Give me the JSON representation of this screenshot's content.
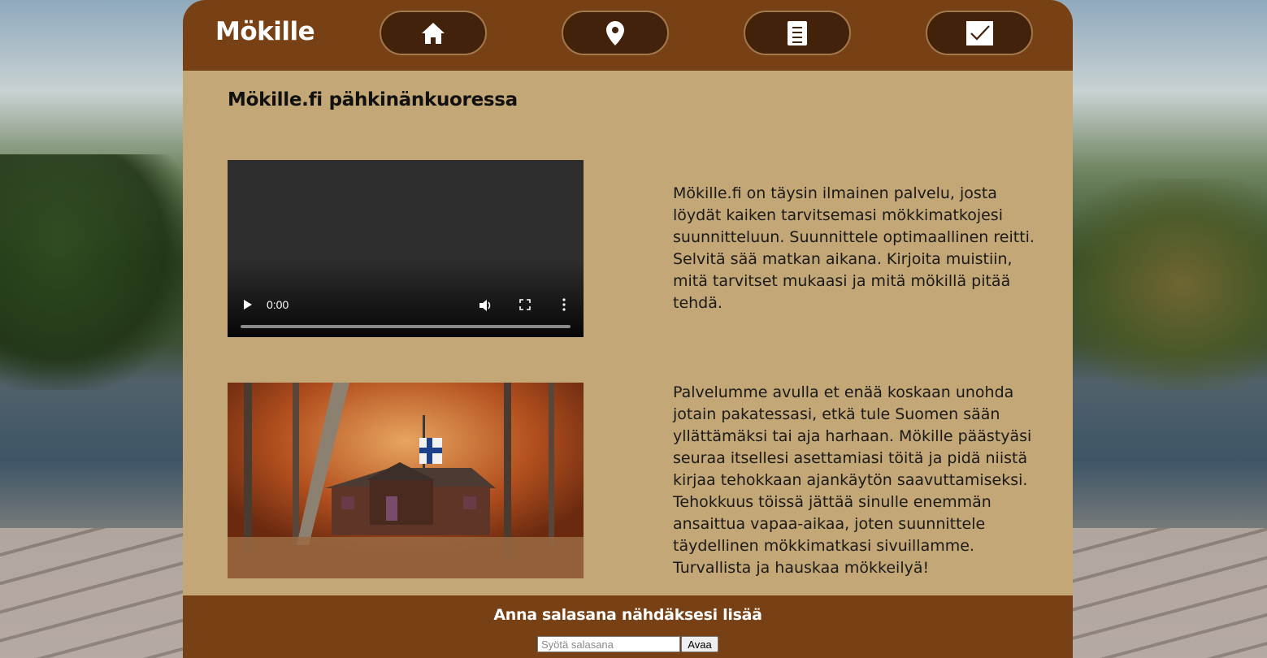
{
  "header": {
    "logo": "Mökille",
    "nav": [
      {
        "icon": "home-icon"
      },
      {
        "icon": "map-pin-icon"
      },
      {
        "icon": "document-icon"
      },
      {
        "icon": "checkbox-icon"
      }
    ]
  },
  "main": {
    "title": "Mökille.fi pähkinänkuoressa",
    "video": {
      "time": "0:00",
      "progress": 0
    },
    "paragraph_1": "Mökille.fi on täysin ilmainen palvelu, josta löydät kaiken tarvitsemasi mökkimatkojesi suunnitteluun. Suunnittele optimaallinen reitti. Selvitä sää matkan aikana. Kirjoita muistiin, mitä tarvitset mukaasi ja mitä mökillä pitää tehdä.",
    "paragraph_2": "Palvelumme avulla et enää koskaan unohda jotain pakatessasi, etkä tule Suomen sään yllättämäksi tai aja harhaan. Mökille päästyäsi seuraa itsellesi asettamiasi töitä ja pidä niistä kirjaa tehokkaan ajankäytön saavuttamiseksi. Tehokkuus töissä jättää sinulle enemmän ansaittua vapaa-aikaa, joten suunnittele täydellinen mökkimatkasi sivuillamme. Turvallista ja hauskaa mökkeilyä!"
  },
  "footer": {
    "title": "Anna salasana nähdäksesi lisää",
    "password_placeholder": "Syötä salasana",
    "password_value": "",
    "submit_label": "Avaa"
  },
  "colors": {
    "header_bg": "#784115",
    "nav_button_bg": "#42220a",
    "content_bg": "#c4a776"
  }
}
